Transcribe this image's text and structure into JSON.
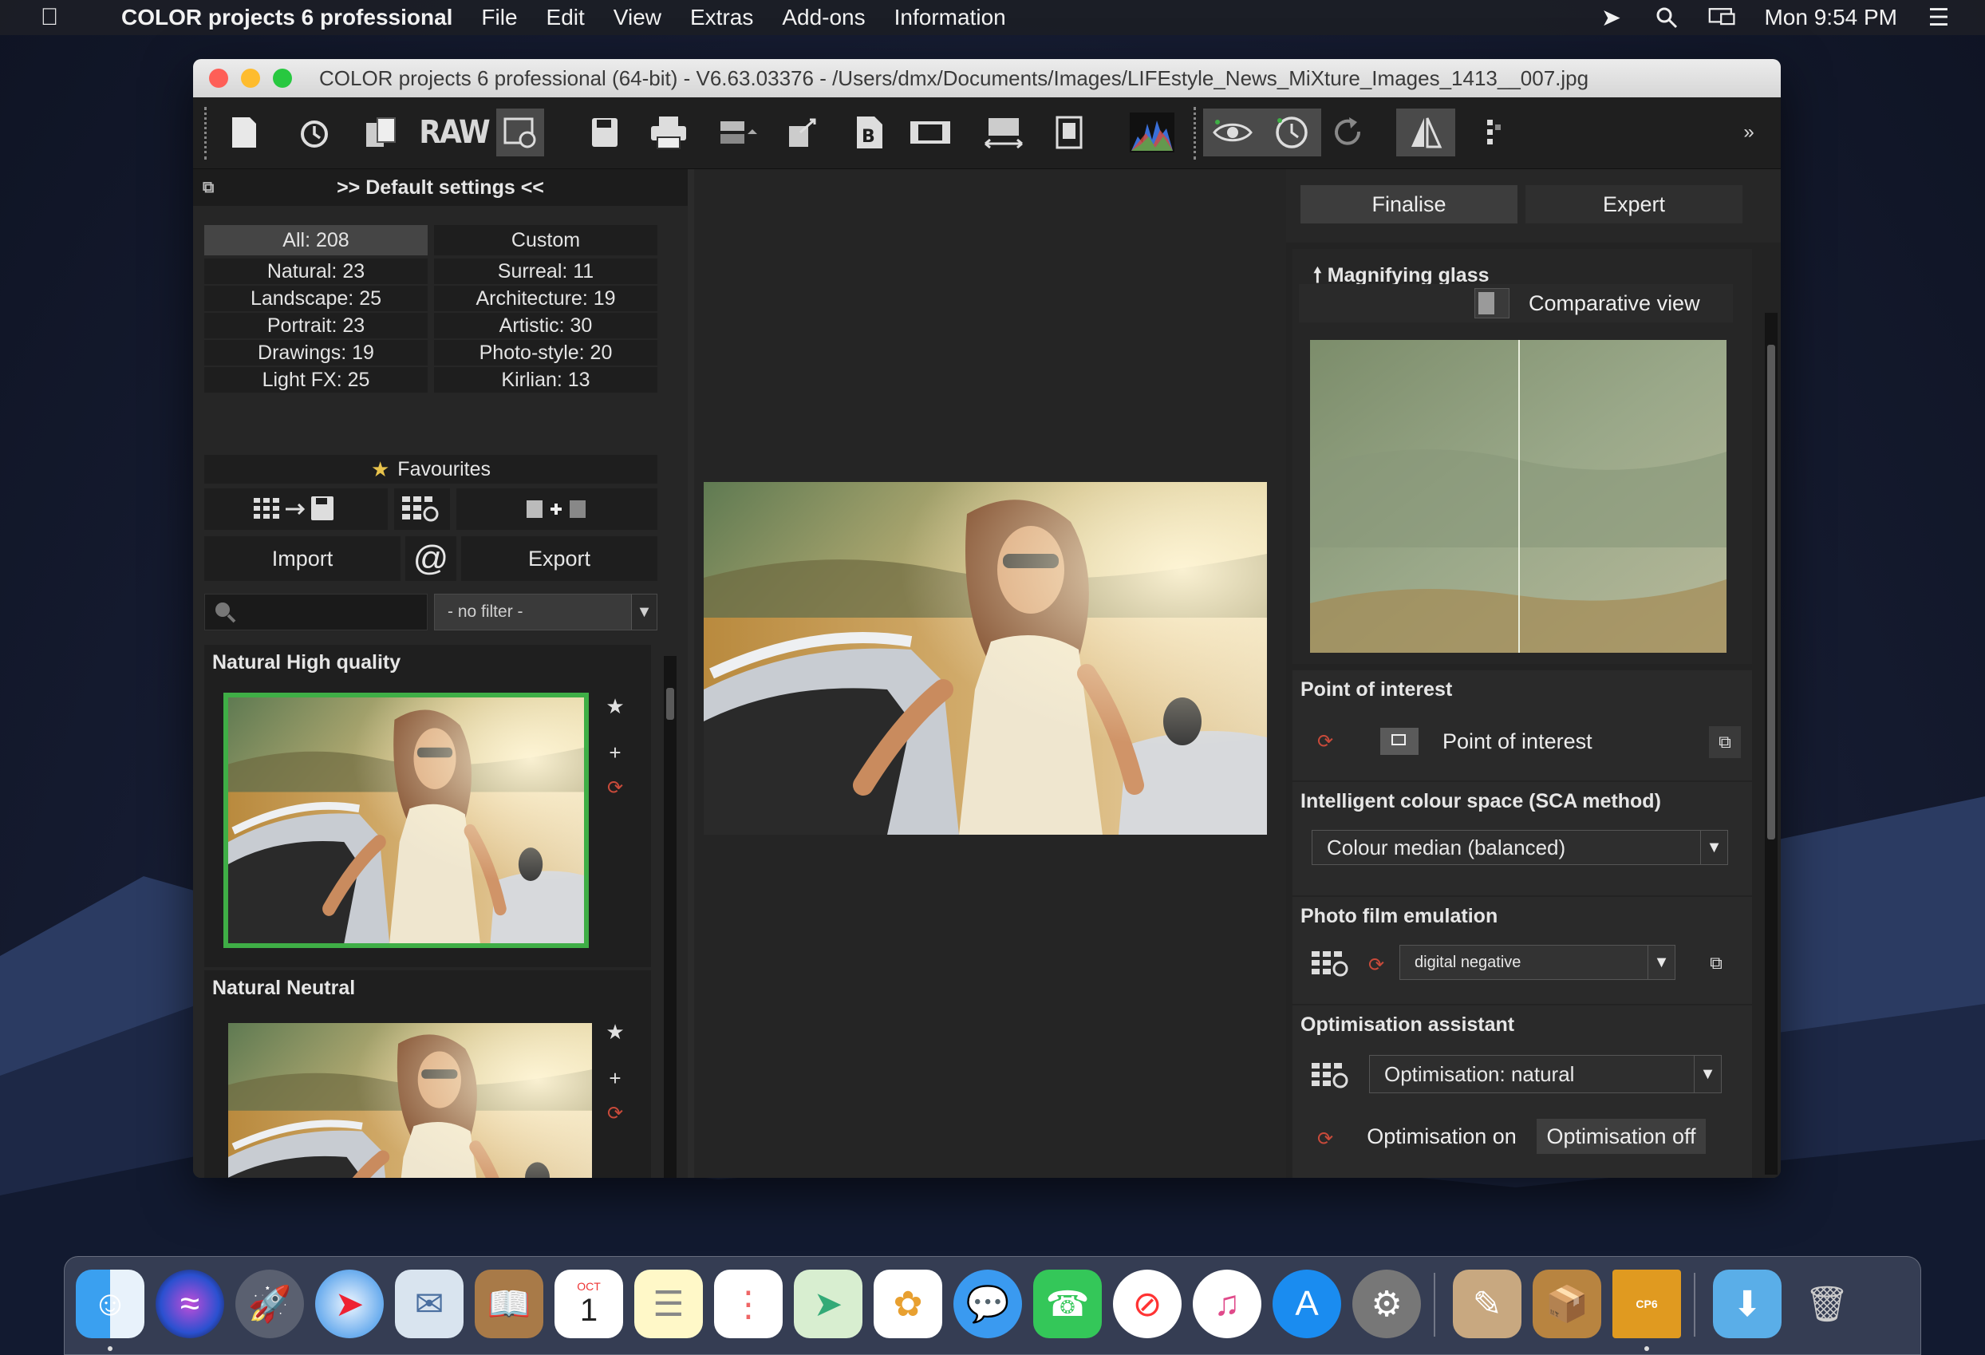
{
  "menubar": {
    "apple": "",
    "app_name": "COLOR projects 6 professional",
    "items": [
      "File",
      "Edit",
      "View",
      "Extras",
      "Add-ons",
      "Information"
    ],
    "clock": "Mon 9:54 PM"
  },
  "window": {
    "title": "COLOR projects 6 professional (64-bit) - V6.63.03376 - /Users/dmx/Documents/Images/LIFEstyle_News_MiXture_Images_1413__007.jpg"
  },
  "toolbar": {
    "raw_label": "RAW"
  },
  "left_panel": {
    "header": ">> Default settings <<",
    "categories": [
      {
        "label": "All: 208",
        "selected": true
      },
      {
        "label": "Custom",
        "selected": false
      },
      {
        "label": "Natural: 23"
      },
      {
        "label": "Surreal: 11"
      },
      {
        "label": "Landscape: 25"
      },
      {
        "label": "Architecture: 19"
      },
      {
        "label": "Portrait: 23"
      },
      {
        "label": "Artistic: 30"
      },
      {
        "label": "Drawings: 19"
      },
      {
        "label": "Photo-style: 20"
      },
      {
        "label": "Light FX: 25"
      },
      {
        "label": "Kirlian: 13"
      }
    ],
    "favourites": "Favourites",
    "import_label": "Import",
    "at_label": "@",
    "export_label": "Export",
    "search_placeholder": "",
    "filter_value": "- no filter -",
    "presets": [
      {
        "name": "Natural High quality",
        "selected": true
      },
      {
        "name": "Natural Neutral",
        "selected": false
      }
    ]
  },
  "right_panel": {
    "tabs": [
      "Finalise",
      "Expert"
    ],
    "magnifying_glass": "Magnifying glass",
    "comparative_view": "Comparative view",
    "point_of_interest_title": "Point of interest",
    "point_of_interest_label": "Point of interest",
    "sca_title": "Intelligent colour space (SCA method)",
    "sca_value": "Colour median (balanced)",
    "film_title": "Photo film emulation",
    "film_value": "digital negative",
    "opt_title": "Optimisation assistant",
    "opt_value": "Optimisation: natural",
    "opt_on": "Optimisation on",
    "opt_off": "Optimisation off"
  },
  "dock": {
    "apps": [
      "Finder",
      "Siri",
      "Launchpad",
      "Safari",
      "Mail",
      "Contacts",
      "Calendar",
      "Notes",
      "Reminders",
      "Maps",
      "Photos",
      "Messages",
      "FaceTime",
      "News",
      "iTunes",
      "App Store",
      "System Preferences",
      "Pixelmator",
      "Archive Utility",
      "COLOR projects",
      "Downloads",
      "Trash"
    ],
    "calendar_month": "OCT",
    "calendar_day": "1"
  },
  "colors": {
    "selection_green": "#3fae46",
    "refresh_red": "#c84a3a",
    "star_yellow": "#e8c34c"
  }
}
